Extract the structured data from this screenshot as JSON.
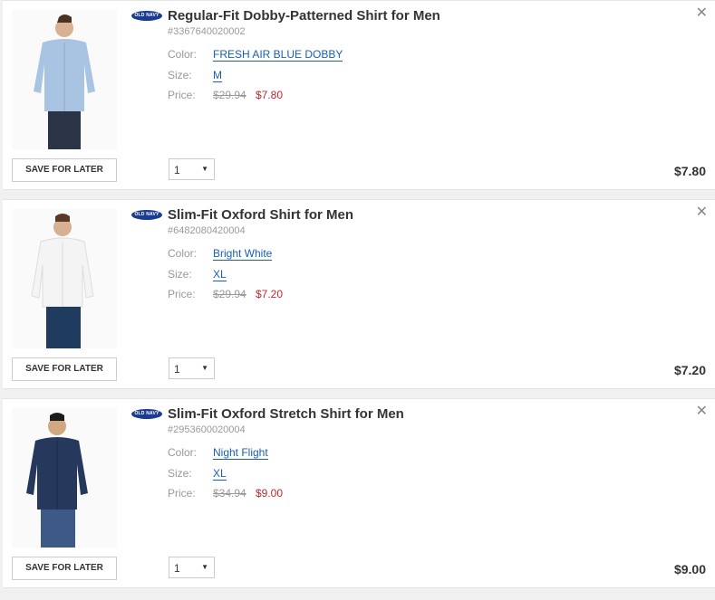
{
  "brand_logo_text": "OLD NAVY",
  "labels": {
    "color": "Color:",
    "size": "Size:",
    "price": "Price:",
    "save_for_later": "SAVE FOR LATER"
  },
  "items": [
    {
      "title": "Regular-Fit Dobby-Patterned Shirt for Men",
      "sku": "#3367640020002",
      "color": "FRESH AIR BLUE DOBBY",
      "size": "M",
      "original_price": "$29.94",
      "sale_price": "$7.80",
      "quantity": "1",
      "total": "$7.80",
      "shirt_color": "#a9c3e3",
      "pants_color": "#2b3347"
    },
    {
      "title": "Slim-Fit Oxford Shirt for Men",
      "sku": "#6482080420004",
      "color": "Bright White",
      "size": "XL",
      "original_price": "$29.94",
      "sale_price": "$7.20",
      "quantity": "1",
      "total": "$7.20",
      "shirt_color": "#f4f4f4",
      "pants_color": "#1f3c5f"
    },
    {
      "title": "Slim-Fit Oxford Stretch Shirt for Men",
      "sku": "#2953600020004",
      "color": "Night Flight",
      "size": "XL",
      "original_price": "$34.94",
      "sale_price": "$9.00",
      "quantity": "1",
      "total": "$9.00",
      "shirt_color": "#26385c",
      "pants_color": "#3c5a85"
    }
  ]
}
